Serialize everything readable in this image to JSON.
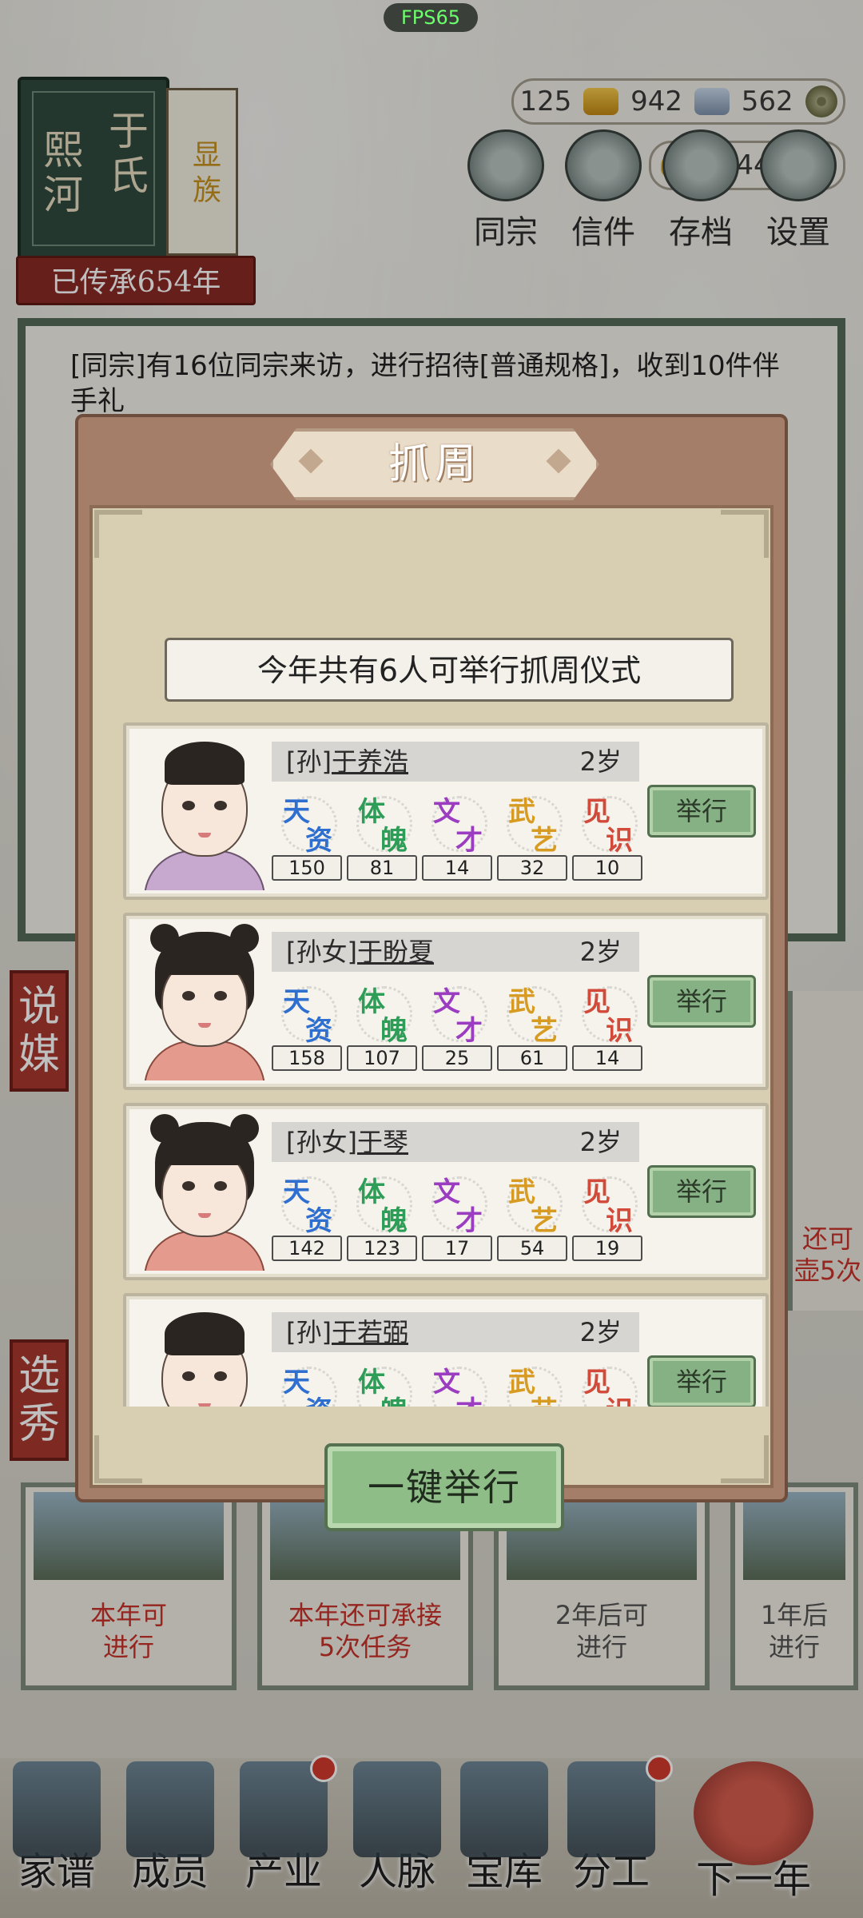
{
  "hud": {
    "fps": "FPS65",
    "clan": {
      "name_col1": "熙河",
      "name_col2": "于氏",
      "tag": "显族",
      "inherit": "已传承654年"
    },
    "resources": {
      "gold_bar": "125",
      "silver": "942",
      "copper": "562",
      "ingot": "2443"
    },
    "top_nav": [
      "同宗",
      "信件",
      "存档",
      "设置"
    ]
  },
  "background": {
    "log_text": "[同宗]有16位同宗来访，进行招待[普通规格]，收到10件伴手礼",
    "side_tags": [
      "说媒",
      "选秀"
    ],
    "cards": [
      {
        "status": "本年可\n进行"
      },
      {
        "status": "本年还可承接\n5次任务"
      },
      {
        "status": "2年后可\n进行"
      },
      {
        "status": "1年后\n进行"
      }
    ],
    "right_status": "还可\n壶5次"
  },
  "bottom_nav": [
    "家谱",
    "成员",
    "产业",
    "人脉",
    "宝库",
    "分工",
    "下一年"
  ],
  "modal": {
    "title": "抓周",
    "summary": "今年共有6人可举行抓周仪式",
    "attr_names": [
      {
        "c1": "天",
        "c2": "资"
      },
      {
        "c1": "体",
        "c2": "魄"
      },
      {
        "c1": "文",
        "c2": "才"
      },
      {
        "c1": "武",
        "c2": "艺"
      },
      {
        "c1": "见",
        "c2": "识"
      }
    ],
    "hold_label": "举行",
    "one_key_label": "一键举行",
    "children": [
      {
        "relation": "[孙]",
        "name": "于养浩",
        "age": "2岁",
        "gender": "boy",
        "stats": [
          "150",
          "81",
          "14",
          "32",
          "10"
        ]
      },
      {
        "relation": "[孙女]",
        "name": "于盼夏",
        "age": "2岁",
        "gender": "girl",
        "stats": [
          "158",
          "107",
          "25",
          "61",
          "14"
        ]
      },
      {
        "relation": "[孙女]",
        "name": "于琴",
        "age": "2岁",
        "gender": "girl",
        "stats": [
          "142",
          "123",
          "17",
          "54",
          "19"
        ]
      },
      {
        "relation": "[孙]",
        "name": "于若弼",
        "age": "2岁",
        "gender": "boy",
        "stats": [
          "",
          "",
          "",
          "",
          ""
        ]
      }
    ]
  }
}
